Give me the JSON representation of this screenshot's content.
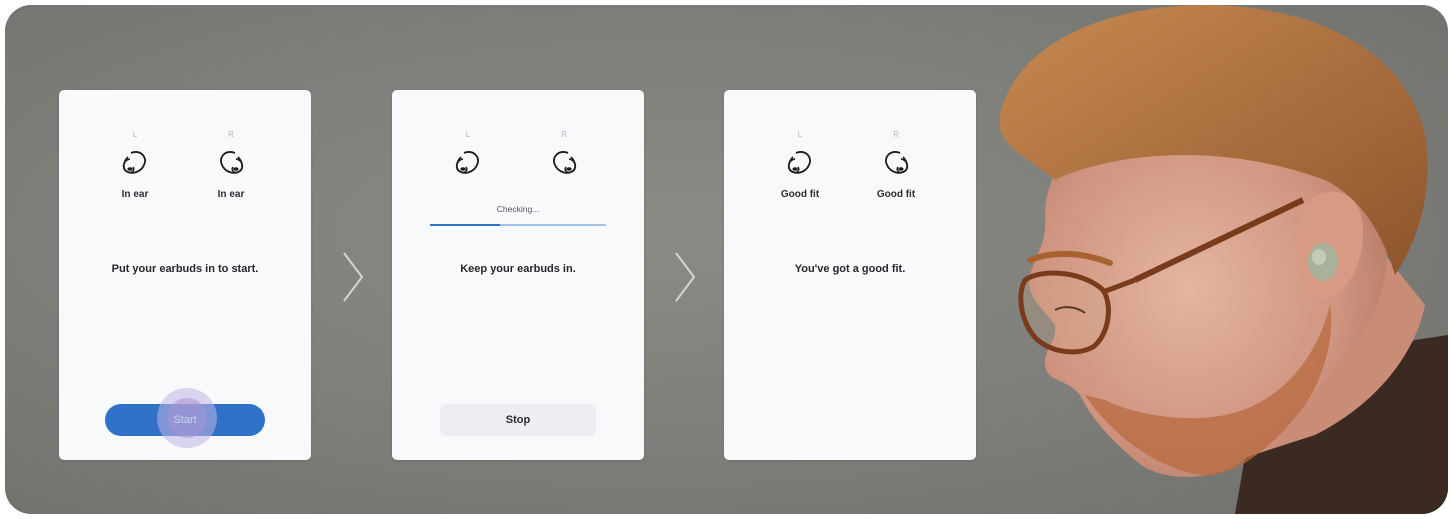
{
  "cards": [
    {
      "left": {
        "label": "L",
        "status": "In ear"
      },
      "right": {
        "label": "R",
        "status": "In ear"
      },
      "message": "Put your earbuds in to start.",
      "button": "Start"
    },
    {
      "left": {
        "label": "L",
        "status": ""
      },
      "right": {
        "label": "R",
        "status": ""
      },
      "checking": "Checking...",
      "progress_percent": 40,
      "message": "Keep your earbuds in.",
      "button": "Stop"
    },
    {
      "left": {
        "label": "L",
        "status": "Good fit"
      },
      "right": {
        "label": "R",
        "status": "Good fit"
      },
      "message": "You've got a good fit."
    }
  ],
  "icons": {
    "earbud": "earbud-icon",
    "arrow": "chevron-right-icon"
  },
  "colors": {
    "accent": "#2f72c8",
    "progress_track": "#9fc4ea",
    "background": "#7f807b",
    "card": "#f8f9fb"
  }
}
